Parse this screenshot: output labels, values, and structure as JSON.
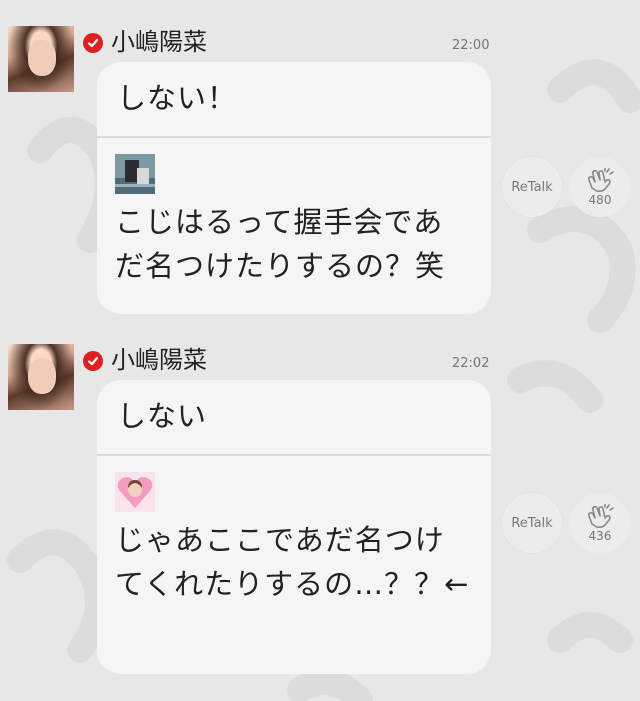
{
  "messages": [
    {
      "sender": "小嶋陽菜",
      "time": "22:00",
      "reply": "しない！",
      "quote_text": "こじはるって握手会であだ名つけたりするの？笑",
      "retalk_label": "ReTalk",
      "clap_count": "480"
    },
    {
      "sender": "小嶋陽菜",
      "time": "22:02",
      "reply": "しない",
      "quote_text": "じゃあここであだ名つけてくれたりするの…？？←",
      "retalk_label": "ReTalk",
      "clap_count": "436"
    }
  ],
  "colors": {
    "background": "#e7e7e7",
    "bubble": "#f5f5f5",
    "verified": "#e02020",
    "circle_button": "#ececec"
  },
  "icons": [
    "verified-check-icon",
    "clap-hands-icon"
  ]
}
